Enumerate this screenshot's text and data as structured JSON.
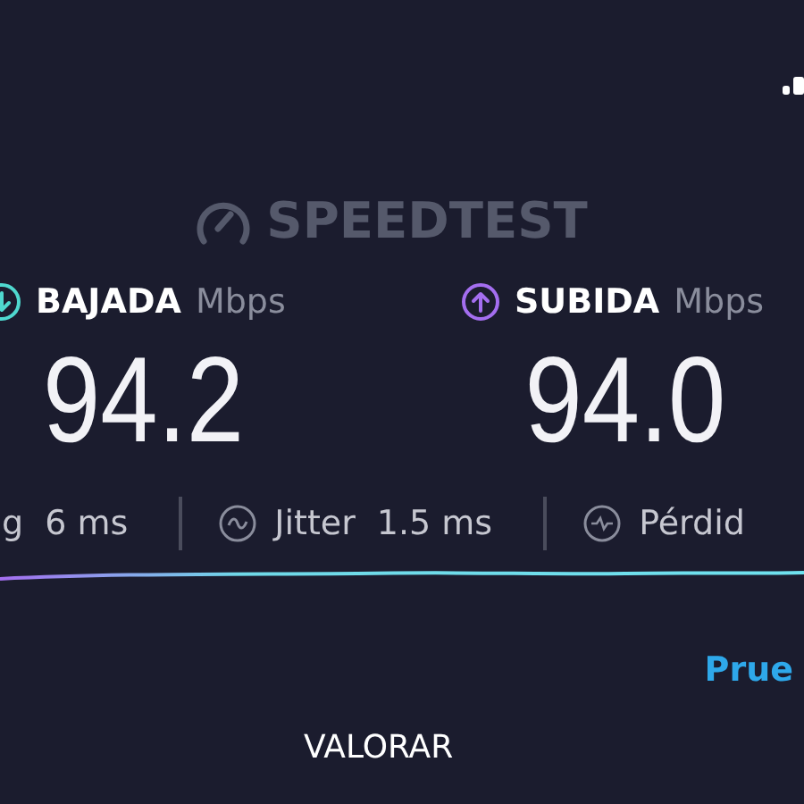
{
  "logo": {
    "text": "SPEEDTEST"
  },
  "results": [
    {
      "kind": "download",
      "label": "BAJADA",
      "unit": "Mbps",
      "value": "94.2",
      "color": "#4fd8cf"
    },
    {
      "kind": "upload",
      "label": "SUBIDA",
      "unit": "Mbps",
      "value": "94.0",
      "color": "#a46ef0"
    }
  ],
  "metrics": [
    {
      "kind": "ping",
      "label": "g",
      "value": "6 ms"
    },
    {
      "kind": "jitter",
      "label": "Jitter",
      "value": "1.5 ms"
    },
    {
      "kind": "loss",
      "label": "Pérdid"
    }
  ],
  "link": "Prue",
  "rate_button": "VALORAR"
}
